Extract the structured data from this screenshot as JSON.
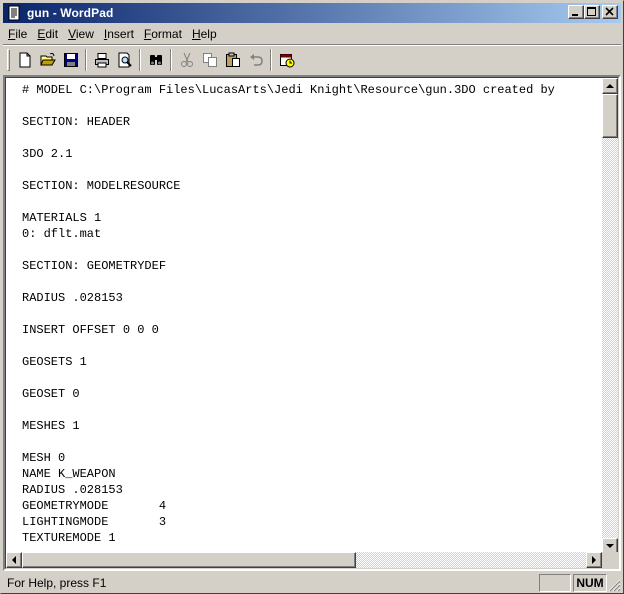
{
  "window": {
    "title": "gun - WordPad"
  },
  "menu": [
    {
      "first": "F",
      "rest": "ile"
    },
    {
      "first": "E",
      "rest": "dit"
    },
    {
      "first": "V",
      "rest": "iew"
    },
    {
      "first": "I",
      "rest": "nsert"
    },
    {
      "first": "F",
      "rest": "ormat"
    },
    {
      "first": "H",
      "rest": "elp"
    }
  ],
  "toolbar": {
    "buttons": [
      "new-icon",
      "open-icon",
      "save-icon",
      "print-icon",
      "print-preview-icon",
      "find-icon",
      "cut-icon",
      "copy-icon",
      "paste-icon",
      "undo-icon",
      "insert-datetime-icon"
    ]
  },
  "document": {
    "lines": [
      "# MODEL C:\\Program Files\\LucasArts\\Jedi Knight\\Resource\\gun.3DO created by",
      "",
      "SECTION: HEADER",
      "",
      "3DO 2.1",
      "",
      "SECTION: MODELRESOURCE",
      "",
      "MATERIALS 1",
      "0: dflt.mat",
      "",
      "SECTION: GEOMETRYDEF",
      "",
      "RADIUS .028153",
      "",
      "INSERT OFFSET 0 0 0",
      "",
      "GEOSETS 1",
      "",
      "GEOSET 0",
      "",
      "MESHES 1",
      "",
      "MESH 0",
      "NAME K_WEAPON",
      "RADIUS .028153",
      "GEOMETRYMODE       4",
      "LIGHTINGMODE       3",
      "TEXTUREMODE 1"
    ]
  },
  "statusbar": {
    "help_text": "For Help, press F1",
    "num_indicator": "NUM"
  },
  "colors": {
    "titlebar_start": "#0a246a",
    "titlebar_end": "#a6caf0",
    "face": "#d4d0c8"
  }
}
